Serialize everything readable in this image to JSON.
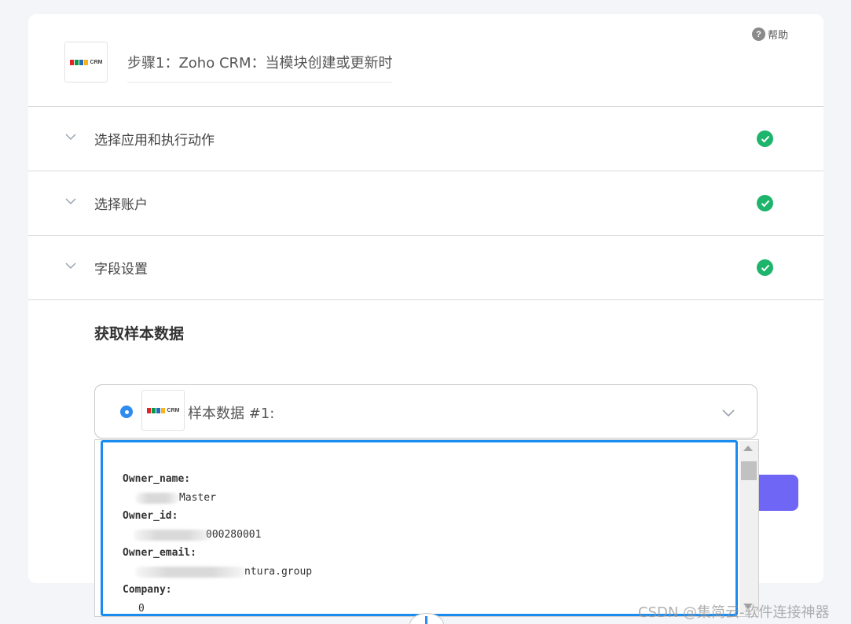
{
  "help": {
    "icon": "question-circle-icon",
    "label": "帮助"
  },
  "step": {
    "logo_text": "CRM",
    "title": "步骤1：Zoho CRM：当模块创建或更新时"
  },
  "sections": [
    {
      "label": "选择应用和执行动作",
      "status": "complete"
    },
    {
      "label": "选择账户",
      "status": "complete"
    },
    {
      "label": "字段设置",
      "status": "complete"
    }
  ],
  "sample": {
    "heading": "获取样本数据",
    "selector_label": "样本数据 #1:",
    "logo_text": "CRM"
  },
  "dropdown": {
    "fields": [
      {
        "key": "Owner_name:",
        "value": "Master"
      },
      {
        "key": "Owner_id:",
        "value": "000280001"
      },
      {
        "key": "Owner_email:",
        "value": "ntura.group"
      },
      {
        "key": "Company:",
        "value": "0"
      }
    ]
  },
  "colors": {
    "accent": "#2e8cf0",
    "success": "#1db46c",
    "primary_button": "#6f66f5"
  },
  "watermark": "CSDN @集简云-软件连接神器"
}
